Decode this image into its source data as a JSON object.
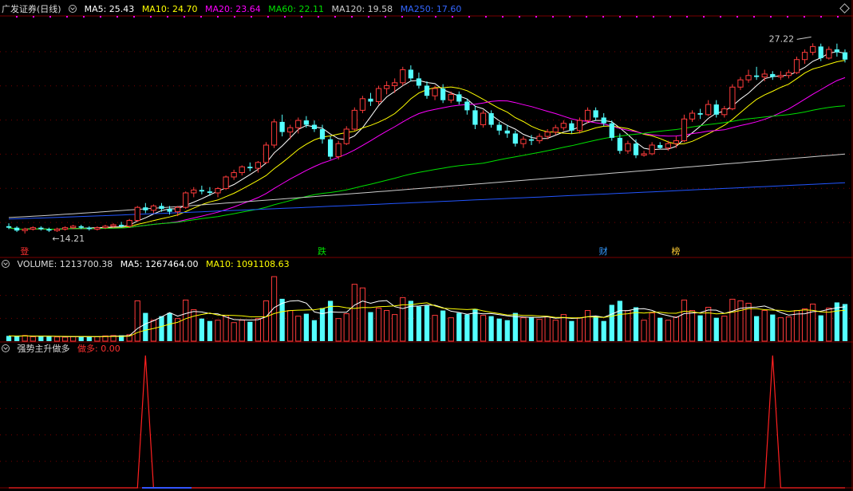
{
  "colors": {
    "up": "#ff3b3b",
    "down": "#54ffff",
    "ma5": "#ffffff",
    "ma10": "#ffff00",
    "ma20": "#ff00ff",
    "ma60": "#00e000",
    "ma120": "#cccccc",
    "ma250": "#2255ff",
    "grid": "#7a0000",
    "indicator": "#ff2020"
  },
  "price_header": {
    "title": "广发证券(日线)",
    "ma5": "MA5: 25.43",
    "ma10": "MA10: 24.70",
    "ma20": "MA20: 23.64",
    "ma60": "MA60: 22.11",
    "ma120": "MA120: 19.58",
    "ma250": "MA250: 17.60"
  },
  "volume_header": {
    "title": "VOLUME: 1213700.38",
    "ma5": "MA5: 1267464.00",
    "ma10": "MA10: 1091108.63"
  },
  "indicator_header": {
    "title": "强势主升做多",
    "value": "做多: 0.00"
  },
  "chart_data": [
    {
      "type": "candlestick",
      "title": "广发证券(日线)",
      "price_range": [
        12.5,
        29.0
      ],
      "annotations": [
        {
          "text": "←14.21",
          "index": 5,
          "price": 14.21
        },
        {
          "text": "27.22",
          "index": 100,
          "price": 27.22
        }
      ],
      "markers": [
        {
          "text": "登",
          "index": 2
        },
        {
          "text": "跌",
          "index": 39
        },
        {
          "text": "财",
          "index": 74
        },
        {
          "text": "榜",
          "index": 83
        }
      ],
      "ohlc": [
        [
          14.6,
          14.8,
          14.4,
          14.5
        ],
        [
          14.5,
          14.6,
          14.2,
          14.3
        ],
        [
          14.3,
          14.5,
          14.1,
          14.4
        ],
        [
          14.4,
          14.6,
          14.3,
          14.5
        ],
        [
          14.5,
          14.6,
          14.3,
          14.4
        ],
        [
          14.4,
          14.5,
          14.2,
          14.3
        ],
        [
          14.3,
          14.5,
          14.21,
          14.4
        ],
        [
          14.4,
          14.6,
          14.3,
          14.5
        ],
        [
          14.5,
          14.7,
          14.4,
          14.6
        ],
        [
          14.6,
          14.7,
          14.4,
          14.5
        ],
        [
          14.5,
          14.6,
          14.3,
          14.4
        ],
        [
          14.4,
          14.6,
          14.3,
          14.5
        ],
        [
          14.5,
          14.7,
          14.4,
          14.6
        ],
        [
          14.6,
          14.8,
          14.5,
          14.7
        ],
        [
          14.7,
          14.9,
          14.5,
          14.6
        ],
        [
          14.6,
          15.1,
          14.5,
          15.0
        ],
        [
          15.0,
          16.0,
          14.9,
          15.9
        ],
        [
          15.9,
          16.2,
          15.5,
          15.7
        ],
        [
          15.7,
          16.1,
          15.5,
          16.0
        ],
        [
          16.0,
          16.2,
          15.6,
          15.8
        ],
        [
          15.8,
          16.0,
          15.4,
          15.6
        ],
        [
          15.6,
          16.0,
          15.3,
          15.9
        ],
        [
          15.9,
          17.0,
          15.8,
          16.9
        ],
        [
          16.9,
          17.3,
          16.6,
          17.1
        ],
        [
          17.1,
          17.4,
          16.8,
          17.0
        ],
        [
          17.0,
          17.3,
          16.7,
          16.9
        ],
        [
          16.9,
          17.3,
          16.6,
          17.2
        ],
        [
          17.2,
          18.1,
          17.1,
          18.0
        ],
        [
          18.0,
          18.5,
          17.8,
          18.3
        ],
        [
          18.3,
          18.8,
          18.1,
          18.7
        ],
        [
          18.7,
          19.0,
          18.4,
          18.6
        ],
        [
          18.6,
          19.1,
          18.3,
          19.0
        ],
        [
          19.0,
          20.4,
          18.9,
          20.2
        ],
        [
          20.2,
          22.0,
          20.0,
          21.8
        ],
        [
          21.8,
          22.3,
          20.8,
          21.1
        ],
        [
          21.1,
          21.6,
          20.6,
          21.4
        ],
        [
          21.4,
          22.1,
          21.0,
          21.9
        ],
        [
          21.9,
          22.2,
          21.4,
          21.6
        ],
        [
          21.6,
          21.9,
          21.1,
          21.3
        ],
        [
          21.3,
          21.6,
          20.3,
          20.6
        ],
        [
          20.6,
          20.8,
          19.2,
          19.4
        ],
        [
          19.4,
          20.5,
          19.2,
          20.3
        ],
        [
          20.3,
          21.5,
          20.2,
          21.3
        ],
        [
          21.3,
          22.8,
          21.2,
          22.6
        ],
        [
          22.6,
          23.6,
          22.4,
          23.4
        ],
        [
          23.4,
          23.8,
          22.9,
          23.2
        ],
        [
          23.2,
          24.3,
          23.0,
          24.1
        ],
        [
          24.1,
          24.6,
          23.7,
          24.3
        ],
        [
          24.3,
          24.8,
          23.8,
          24.5
        ],
        [
          24.5,
          25.6,
          24.3,
          25.4
        ],
        [
          25.4,
          25.7,
          24.6,
          24.8
        ],
        [
          24.8,
          25.2,
          24.1,
          24.3
        ],
        [
          24.3,
          24.6,
          23.4,
          23.6
        ],
        [
          23.6,
          24.3,
          23.3,
          24.1
        ],
        [
          24.1,
          24.4,
          23.1,
          23.3
        ],
        [
          23.3,
          23.9,
          23.1,
          23.7
        ],
        [
          23.7,
          23.9,
          23.0,
          23.2
        ],
        [
          23.2,
          23.4,
          22.3,
          22.6
        ],
        [
          22.6,
          22.9,
          21.3,
          21.6
        ],
        [
          21.6,
          22.6,
          21.4,
          22.4
        ],
        [
          22.4,
          22.6,
          21.4,
          21.6
        ],
        [
          21.6,
          21.8,
          20.9,
          21.2
        ],
        [
          21.2,
          21.6,
          20.7,
          21.0
        ],
        [
          21.0,
          21.2,
          20.1,
          20.3
        ],
        [
          20.3,
          20.8,
          20.0,
          20.6
        ],
        [
          20.6,
          20.9,
          20.2,
          20.5
        ],
        [
          20.5,
          21.0,
          20.3,
          20.8
        ],
        [
          20.8,
          21.3,
          20.6,
          21.1
        ],
        [
          21.1,
          21.6,
          20.9,
          21.4
        ],
        [
          21.4,
          21.9,
          21.2,
          21.7
        ],
        [
          21.7,
          21.9,
          21.0,
          21.2
        ],
        [
          21.2,
          22.1,
          21.0,
          21.9
        ],
        [
          21.9,
          22.8,
          21.7,
          22.6
        ],
        [
          22.6,
          22.8,
          21.9,
          22.1
        ],
        [
          22.1,
          22.4,
          21.5,
          21.7
        ],
        [
          21.7,
          21.9,
          20.5,
          20.7
        ],
        [
          20.7,
          21.0,
          19.6,
          19.8
        ],
        [
          19.8,
          20.5,
          19.6,
          20.3
        ],
        [
          20.3,
          20.6,
          19.3,
          19.5
        ],
        [
          19.5,
          19.8,
          19.4,
          19.6
        ],
        [
          19.6,
          20.4,
          19.5,
          20.2
        ],
        [
          20.2,
          20.4,
          19.9,
          20.0
        ],
        [
          20.0,
          20.5,
          19.8,
          20.3
        ],
        [
          20.3,
          20.8,
          20.0,
          20.5
        ],
        [
          20.5,
          22.3,
          20.4,
          22.0
        ],
        [
          22.0,
          22.6,
          21.8,
          22.4
        ],
        [
          22.4,
          22.7,
          22.0,
          22.3
        ],
        [
          22.3,
          23.3,
          22.2,
          23.0
        ],
        [
          23.0,
          23.3,
          22.1,
          22.3
        ],
        [
          22.3,
          22.9,
          22.1,
          22.7
        ],
        [
          22.7,
          24.4,
          22.6,
          24.2
        ],
        [
          24.2,
          24.9,
          24.0,
          24.7
        ],
        [
          24.7,
          25.4,
          24.5,
          25.0
        ],
        [
          25.0,
          25.6,
          24.7,
          24.9
        ],
        [
          24.9,
          25.4,
          24.6,
          25.1
        ],
        [
          25.1,
          25.3,
          24.7,
          24.9
        ],
        [
          24.9,
          25.3,
          24.7,
          25.0
        ],
        [
          25.0,
          25.4,
          24.8,
          25.2
        ],
        [
          25.2,
          26.3,
          25.1,
          26.1
        ],
        [
          26.1,
          26.8,
          25.8,
          26.6
        ],
        [
          26.6,
          27.22,
          26.4,
          27.0
        ],
        [
          27.0,
          27.2,
          26.0,
          26.2
        ],
        [
          26.2,
          27.0,
          26.1,
          26.8
        ],
        [
          26.8,
          27.2,
          26.3,
          26.6
        ],
        [
          26.6,
          26.8,
          25.9,
          26.1
        ]
      ],
      "ma_lines": [
        {
          "name": "MA5",
          "color_key": "ma5"
        },
        {
          "name": "MA10",
          "color_key": "ma10"
        },
        {
          "name": "MA20",
          "color_key": "ma20"
        },
        {
          "name": "MA60",
          "color_key": "ma60"
        },
        {
          "name": "MA120",
          "color_key": "ma120",
          "start": 15.2,
          "end": 19.58
        },
        {
          "name": "MA250",
          "color_key": "ma250",
          "start": 15.1,
          "end": 17.6
        }
      ]
    },
    {
      "type": "bar",
      "title": "VOLUME",
      "ylim": [
        0,
        1700000
      ],
      "values": [
        130000,
        120000,
        140000,
        110000,
        125000,
        115000,
        105000,
        100000,
        110000,
        120000,
        115000,
        110000,
        130000,
        140000,
        145000,
        160000,
        1000000,
        700000,
        520000,
        620000,
        700000,
        560000,
        1020000,
        780000,
        560000,
        500000,
        520000,
        640000,
        460000,
        520000,
        480000,
        560000,
        1000000,
        1600000,
        1050000,
        760000,
        620000,
        680000,
        520000,
        820000,
        1000000,
        560000,
        680000,
        1410000,
        1320000,
        720000,
        820000,
        760000,
        660000,
        1080000,
        1000000,
        860000,
        880000,
        640000,
        760000,
        580000,
        700000,
        660000,
        800000,
        640000,
        620000,
        560000,
        520000,
        700000,
        580000,
        600000,
        540000,
        600000,
        520000,
        660000,
        500000,
        580000,
        760000,
        620000,
        500000,
        900000,
        1000000,
        760000,
        840000,
        520000,
        700000,
        580000,
        520000,
        600000,
        1020000,
        760000,
        640000,
        840000,
        580000,
        620000,
        1040000,
        1000000,
        940000,
        620000,
        760000,
        660000,
        580000,
        600000,
        760000,
        800000,
        920000,
        640000,
        820000,
        960000,
        920000
      ],
      "ma5_color_key": "ma5",
      "ma10_color_key": "ma10"
    },
    {
      "type": "line",
      "title": "强势主升做多",
      "ylim": [
        0,
        1
      ],
      "spike_indices": [
        17,
        95
      ]
    }
  ]
}
